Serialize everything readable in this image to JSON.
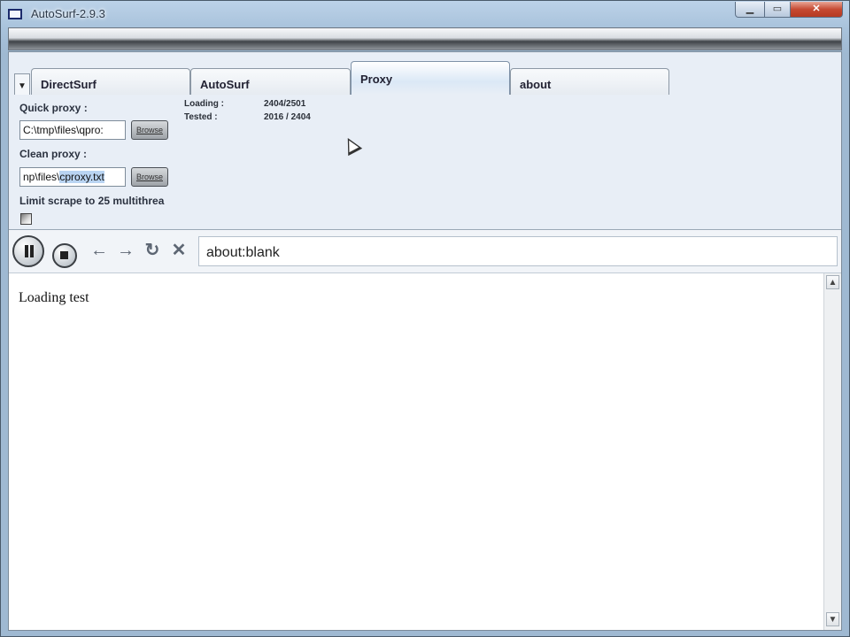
{
  "window": {
    "title": "AutoSurf-2.9.3"
  },
  "titlebar": {
    "minimize": "▁",
    "maximize": "▭",
    "close": "✕"
  },
  "tabs": [
    {
      "label": "DirectSurf"
    },
    {
      "label": "AutoSurf"
    },
    {
      "label": "Proxy"
    },
    {
      "label": "about"
    }
  ],
  "tab_dropdown": "▼",
  "proxy": {
    "quick_label": "Quick proxy :",
    "quick_value": "C:\\tmp\\files\\qpro:",
    "quick_browse": "Browse",
    "clean_label": "Clean proxy :",
    "clean_value_pre": "np\\files\\",
    "clean_value_sel": "cproxy.txt",
    "clean_browse": "Browse",
    "limit_label": "Limit scrape to 25 multithrea",
    "limit_checked": true,
    "stats": {
      "loading_label": "Loading :",
      "loading_value": "2404/2501",
      "tested_label": "Tested :",
      "tested_value": "2016 / 2404"
    }
  },
  "toolbar": {
    "url": "about:blank",
    "back_icon": "←",
    "forward_icon": "→",
    "refresh_icon": "↻",
    "stop_icon": "✕"
  },
  "content": {
    "text": "Loading test"
  },
  "scrollbar": {
    "up": "▲",
    "down": "▼"
  }
}
